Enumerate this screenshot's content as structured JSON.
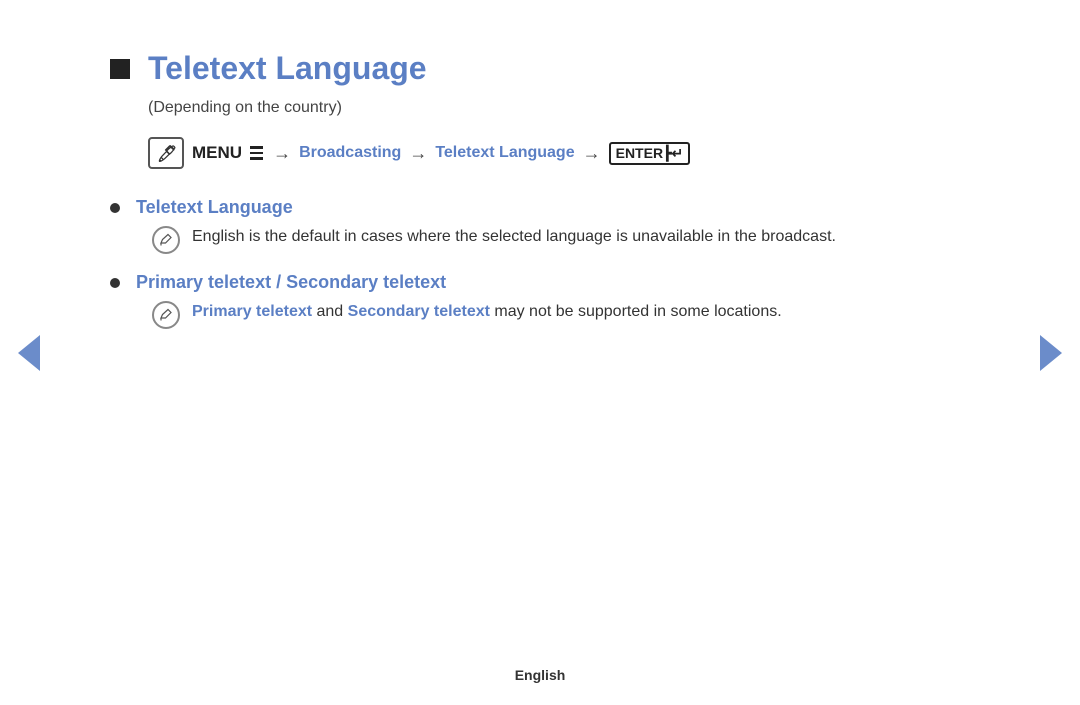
{
  "title": "Teletext Language",
  "subtitle": "(Depending on the country)",
  "menu": {
    "menu_label": "MENU",
    "arrows": [
      "→",
      "→",
      "→"
    ],
    "path_items": [
      "Broadcasting",
      "Teletext Language"
    ],
    "enter_label": "ENTER"
  },
  "bullet1": {
    "label": "Teletext Language",
    "note": "English is the default in cases where the selected language is unavailable in the broadcast."
  },
  "bullet2": {
    "label": "Primary teletext / Secondary teletext",
    "note_parts": {
      "part1": "Primary teletext",
      "part2": " and ",
      "part3": "Secondary teletext",
      "part4": " may not be supported in some locations."
    }
  },
  "footer": "English",
  "nav": {
    "left_label": "prev",
    "right_label": "next"
  }
}
